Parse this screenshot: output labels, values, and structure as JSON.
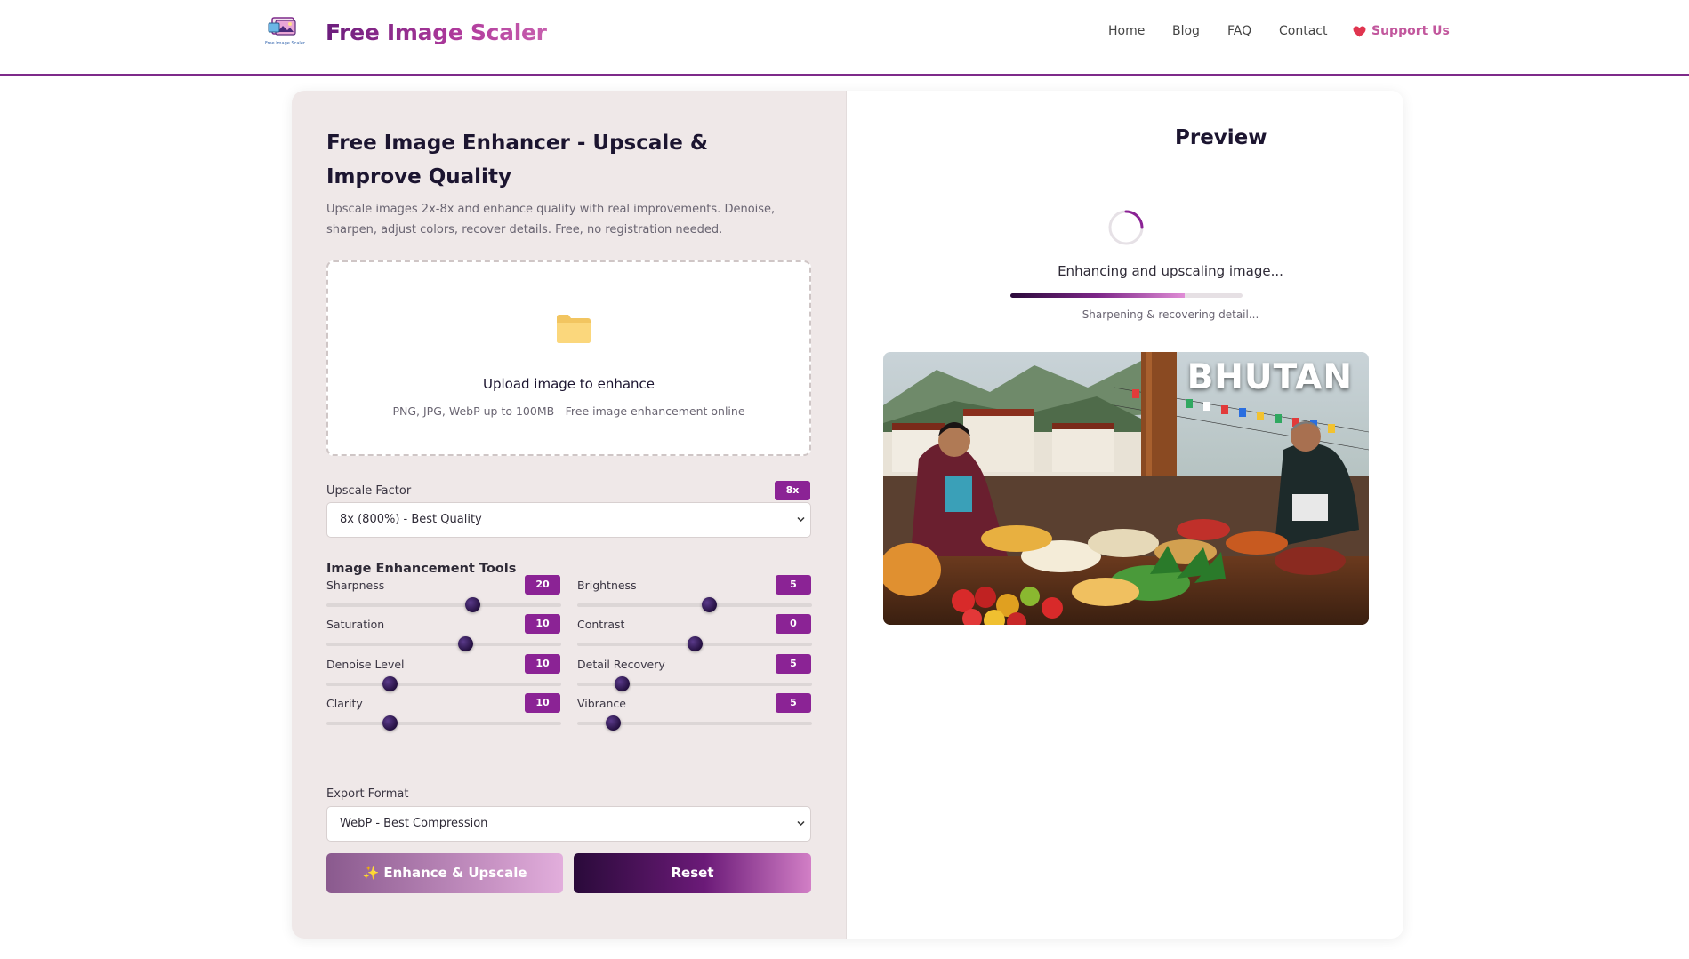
{
  "header": {
    "brand": "Free Image Scaler",
    "logo_alt": "Free Image Scaler",
    "nav": [
      "Home",
      "Blog",
      "FAQ",
      "Contact"
    ],
    "support": "Support Us"
  },
  "tool": {
    "title": "Free Image Enhancer - Upscale & Improve Quality",
    "subtitle": "Upscale images 2x-8x and enhance quality with real improvements. Denoise, sharpen, adjust colors, recover details. Free, no registration needed.",
    "upload_title": "Upload image to enhance",
    "upload_sub": "PNG, JPG, WebP up to 100MB - Free image enhancement online",
    "upscale_label": "Upscale Factor",
    "upscale_badge": "8x",
    "upscale_selected": "8x (800%) - Best Quality",
    "tools_title": "Image Enhancement Tools",
    "sliders": [
      {
        "label": "Sharpness",
        "value": "20",
        "level": 0.62
      },
      {
        "label": "Brightness",
        "value": "5",
        "level": 0.56
      },
      {
        "label": "Saturation",
        "value": "10",
        "level": 0.59
      },
      {
        "label": "Contrast",
        "value": "0",
        "level": 0.5
      },
      {
        "label": "Denoise Level",
        "value": "10",
        "level": 0.27
      },
      {
        "label": "Detail Recovery",
        "value": "5",
        "level": 0.19
      },
      {
        "label": "Clarity",
        "value": "10",
        "level": 0.27
      },
      {
        "label": "Vibrance",
        "value": "5",
        "level": 0.15
      }
    ],
    "export_label": "Export Format",
    "export_selected": "WebP - Best Compression",
    "enhance_button": "✨ Enhance & Upscale",
    "reset_button": "Reset"
  },
  "preview": {
    "title": "Preview",
    "status": "Enhancing and upscaling image...",
    "progress": 0.75,
    "progress_text": "Sharpening & recovering detail...",
    "image_label": "BHUTAN"
  },
  "colors": {
    "accent": "#8b2395",
    "brand_start": "#6b1d7c",
    "brand_end": "#c75fae",
    "panel_bg": "#efe8e8",
    "support": "#c2579d"
  }
}
